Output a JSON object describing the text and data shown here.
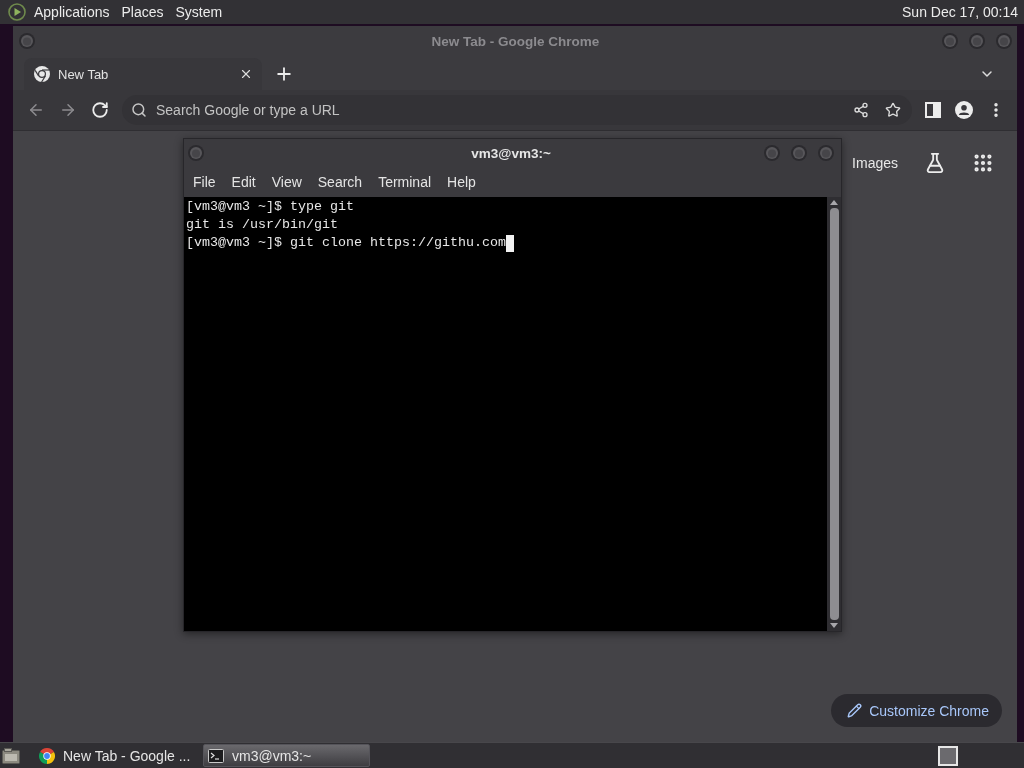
{
  "top_panel": {
    "menus": [
      "Applications",
      "Places",
      "System"
    ],
    "clock": "Sun Dec 17, 00:14"
  },
  "browser": {
    "title": "New Tab - Google Chrome",
    "tabs": [
      {
        "label": "New Tab",
        "selected": true
      }
    ],
    "omnibox": {
      "placeholder": "Search Google or type a URL"
    },
    "header_links": [
      "Images"
    ],
    "customize_button": "Customize Chrome"
  },
  "terminal": {
    "title": "vm3@vm3:~",
    "menus": [
      "File",
      "Edit",
      "View",
      "Search",
      "Terminal",
      "Help"
    ],
    "lines": [
      "[vm3@vm3 ~]$ type git",
      "git is /usr/bin/git",
      "[vm3@vm3 ~]$ git clone https://githu.com"
    ]
  },
  "taskbar": {
    "items": [
      {
        "kind": "browser",
        "label": "New Tab - Google ...",
        "selected": false
      },
      {
        "kind": "terminal",
        "label": "vm3@vm3:~",
        "selected": true
      }
    ]
  }
}
